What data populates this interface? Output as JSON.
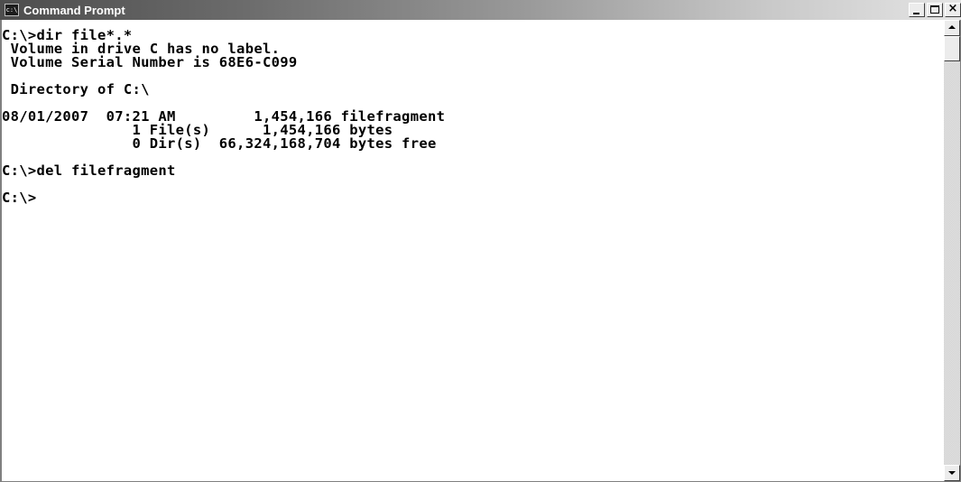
{
  "window": {
    "title": "Command Prompt",
    "icon": "cmd-icon",
    "icon_text": "c:\\"
  },
  "console": {
    "lines": [
      "C:\\>dir file*.*",
      " Volume in drive C has no label.",
      " Volume Serial Number is 68E6-C099",
      "",
      " Directory of C:\\",
      "",
      "08/01/2007  07:21 AM         1,454,166 filefragment",
      "               1 File(s)      1,454,166 bytes",
      "               0 Dir(s)  66,324,168,704 bytes free",
      "",
      "C:\\>del filefragment",
      "",
      "C:\\>"
    ]
  },
  "controls": {
    "minimize": "minimize-icon",
    "maximize": "maximize-icon",
    "close": "close-icon",
    "close_glyph": "×"
  },
  "scrollbar": {
    "up": "scroll-up-arrow-icon",
    "down": "scroll-down-arrow-icon"
  },
  "colors": {
    "console_background": "#ffffff",
    "console_text": "#000000"
  }
}
